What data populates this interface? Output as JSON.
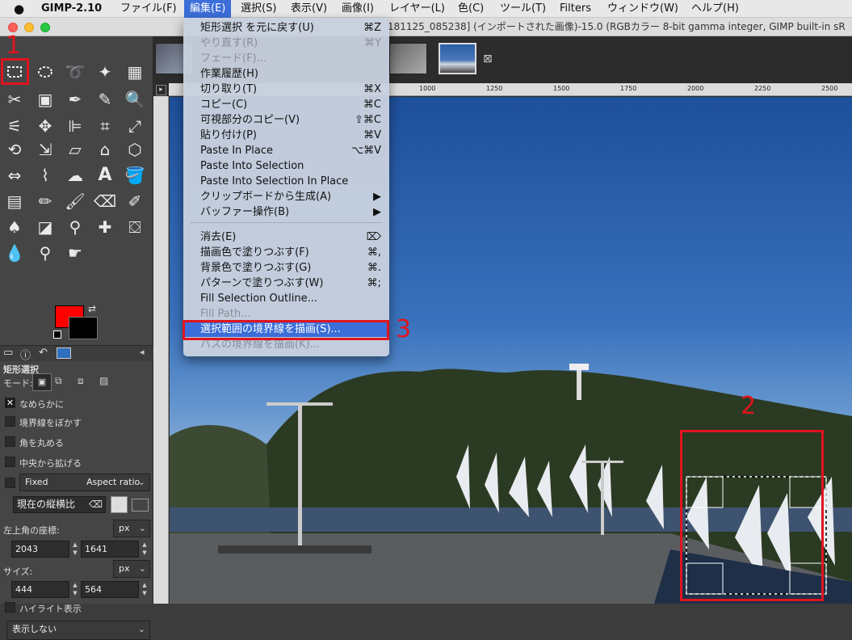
{
  "menubar": {
    "app_name": "GIMP-2.10",
    "items": [
      {
        "label": "ファイル(F)"
      },
      {
        "label": "編集(E)"
      },
      {
        "label": "選択(S)"
      },
      {
        "label": "表示(V)"
      },
      {
        "label": "画像(I)"
      },
      {
        "label": "レイヤー(L)"
      },
      {
        "label": "色(C)"
      },
      {
        "label": "ツール(T)"
      },
      {
        "label": "Filters"
      },
      {
        "label": "ウィンドウ(W)"
      },
      {
        "label": "ヘルプ(H)"
      }
    ]
  },
  "window": {
    "title": "181125_085238] (インポートされた画像)-15.0 (RGBカラー 8-bit gamma integer, GIMP built-in sR"
  },
  "annotations": {
    "n1": "1",
    "n2": "2",
    "n3": "3"
  },
  "tool_options": {
    "title": "矩形選択",
    "mode_label": "モード:",
    "antialias": "なめらかに",
    "feather": "境界線をぼかす",
    "round_corners": "角を丸める",
    "expand_center": "中央から拡げる",
    "fixed": "Fixed",
    "aspect": "Aspect ratio",
    "ratio_field": "現在の縦横比",
    "position_label": "左上角の座標:",
    "pos_unit": "px",
    "pos_x": "2043",
    "pos_y": "1641",
    "size_label": "サイズ:",
    "size_unit": "px",
    "size_w": "444",
    "size_h": "564",
    "highlight": "ハイライト表示",
    "guides": "表示しない"
  },
  "ruler": {
    "ticks": [
      "1000",
      "1250",
      "1500",
      "1750",
      "2000",
      "2250",
      "2500"
    ]
  },
  "edit_menu": {
    "items": [
      {
        "label": "矩形選択 を元に戻す(U)",
        "shortcut": "⌘Z",
        "disabled": false
      },
      {
        "label": "やり直す(R)",
        "shortcut": "⌘Y",
        "disabled": true
      },
      {
        "label": "フェード(F)...",
        "shortcut": "",
        "disabled": true
      },
      {
        "label": "作業履歴(H)",
        "shortcut": "",
        "disabled": false
      },
      {
        "label": "切り取り(T)",
        "shortcut": "⌘X",
        "disabled": false
      },
      {
        "label": "コピー(C)",
        "shortcut": "⌘C",
        "disabled": false
      },
      {
        "label": "可視部分のコピー(V)",
        "shortcut": "⇧⌘C",
        "disabled": false
      },
      {
        "label": "貼り付け(P)",
        "shortcut": "⌘V",
        "disabled": false
      },
      {
        "label": "Paste In Place",
        "shortcut": "⌥⌘V",
        "disabled": false
      },
      {
        "label": "Paste Into Selection",
        "shortcut": "",
        "disabled": false
      },
      {
        "label": "Paste Into Selection In Place",
        "shortcut": "",
        "disabled": false
      },
      {
        "label": "クリップボードから生成(A)",
        "shortcut": "▶",
        "disabled": false
      },
      {
        "label": "バッファー操作(B)",
        "shortcut": "▶",
        "disabled": false
      },
      {
        "label": "消去(E)",
        "shortcut": "⌦",
        "disabled": false
      },
      {
        "label": "描画色で塗りつぶす(F)",
        "shortcut": "⌘,",
        "disabled": false
      },
      {
        "label": "背景色で塗りつぶす(G)",
        "shortcut": "⌘.",
        "disabled": false
      },
      {
        "label": "パターンで塗りつぶす(W)",
        "shortcut": "⌘;",
        "disabled": false
      },
      {
        "label": "Fill Selection Outline...",
        "shortcut": "",
        "disabled": false
      },
      {
        "label": "Fill Path...",
        "shortcut": "",
        "disabled": true
      },
      {
        "label": "選択範囲の境界線を描画(S)...",
        "shortcut": "",
        "disabled": false,
        "highlighted": true
      },
      {
        "label": "パスの境界線を描画(K)...",
        "shortcut": "",
        "disabled": true
      }
    ]
  }
}
